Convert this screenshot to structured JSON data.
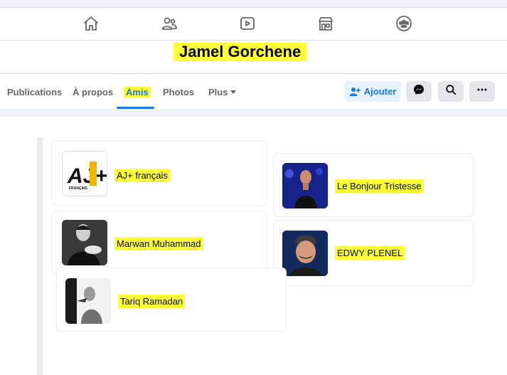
{
  "header": {
    "nav_icons": [
      "home-icon",
      "friends-icon",
      "watch-icon",
      "marketplace-icon",
      "groups-icon"
    ]
  },
  "profile": {
    "name": "Jamel Gorchene"
  },
  "tabs": [
    {
      "label": "Publications"
    },
    {
      "label": "À propos"
    },
    {
      "label": "Amis",
      "active": true
    },
    {
      "label": "Photos"
    },
    {
      "label": "Plus"
    }
  ],
  "actions": {
    "add_label": "Ajouter",
    "icons": [
      "add-friend-icon",
      "messenger-icon",
      "search-icon",
      "more-icon"
    ]
  },
  "friends": [
    {
      "name": "AJ+ français"
    },
    {
      "name": "Le Bonjour Tristesse"
    },
    {
      "name": "Marwan Muhammad"
    },
    {
      "name": "EDWY PLENEL"
    },
    {
      "name": "Tariq Ramadan"
    }
  ],
  "logo_text": {
    "main": "AJ+",
    "sub": "FRANÇAIS"
  },
  "colors": {
    "accent": "#1877f2",
    "highlight": "#fdfd3a",
    "muted": "#65676b"
  }
}
